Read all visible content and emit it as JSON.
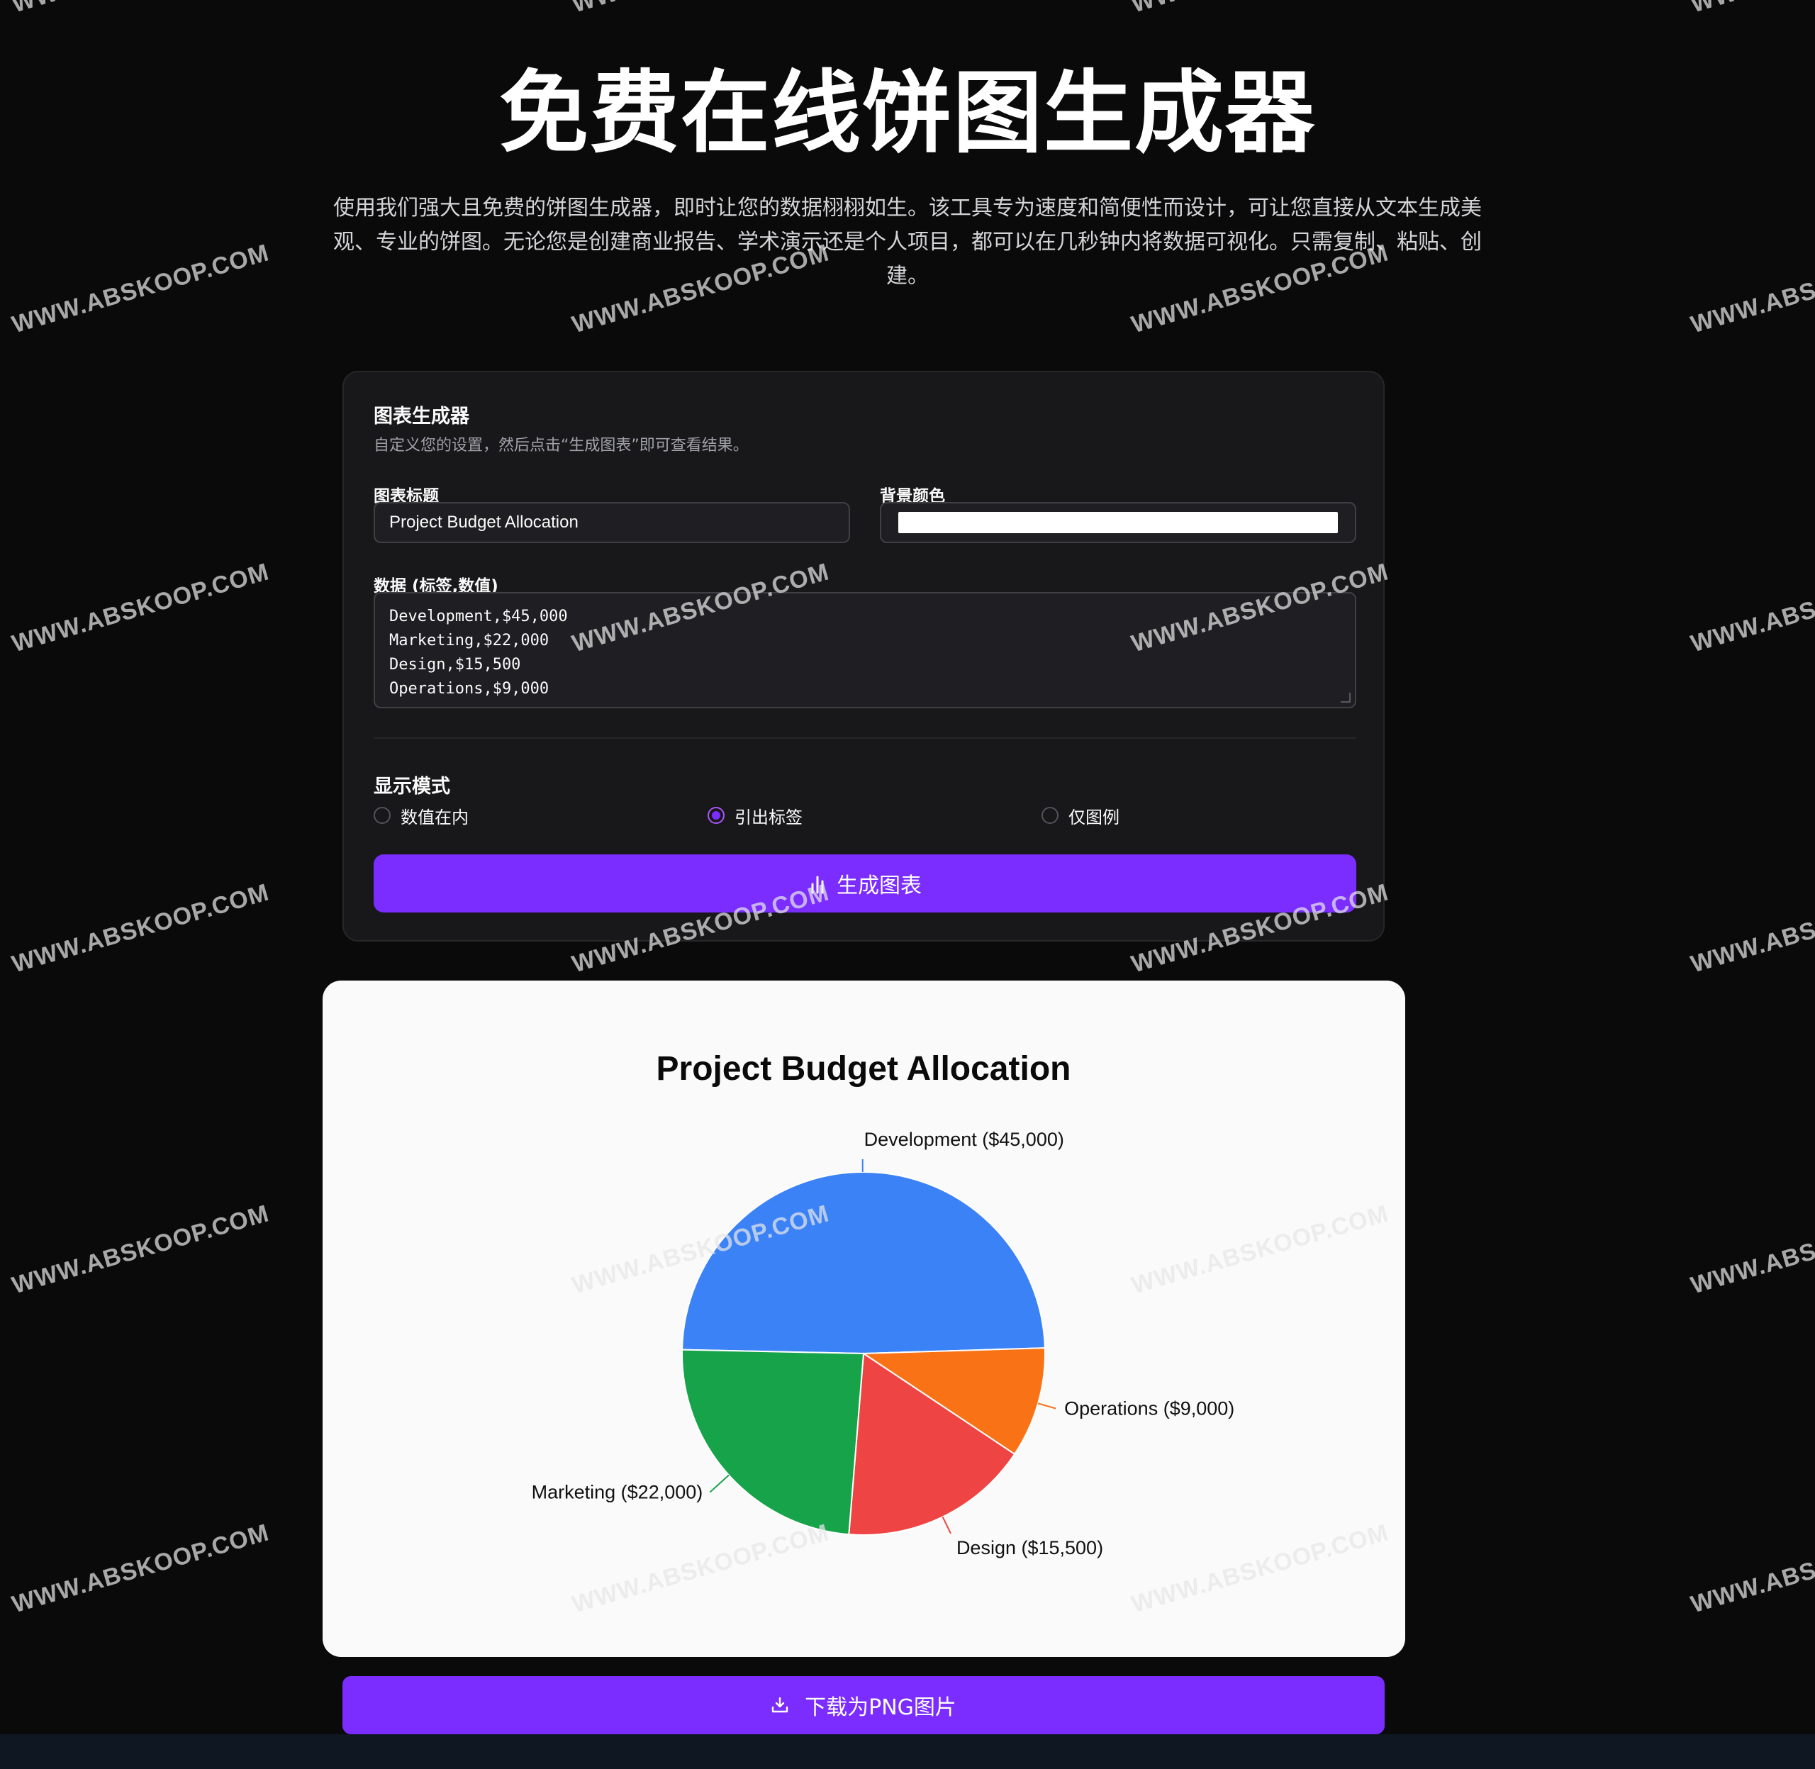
{
  "hero": {
    "title": "免费在线饼图生成器",
    "description": "使用我们强大且免费的饼图生成器，即时让您的数据栩栩如生。该工具专为速度和简便性而设计，可让您直接从文本生成美观、专业的饼图。无论您是创建商业报告、学术演示还是个人项目，都可以在几秒钟内将数据可视化。只需复制、粘贴、创建。"
  },
  "generator": {
    "title": "图表生成器",
    "subtitle": "自定义您的设置，然后点击“生成图表”即可查看结果。",
    "chart_title_label": "图表标题",
    "chart_title_value": "Project Budget Allocation",
    "bg_color_label": "背景颜色",
    "bg_color_value": "#ffffff",
    "data_label": "数据 (标签,数值)",
    "data_lines": [
      "Development,$45,000",
      "Marketing,$22,000",
      "Design,$15,500",
      "Operations,$9,000"
    ],
    "display_mode_label": "显示模式",
    "modes": [
      {
        "label": "数值在内",
        "selected": false
      },
      {
        "label": "引出标签",
        "selected": true
      },
      {
        "label": "仅图例",
        "selected": false
      }
    ],
    "generate_label": "生成图表",
    "generate_icon": "chart-icon"
  },
  "chart_data": {
    "type": "pie",
    "title": "Project Budget Allocation",
    "categories": [
      "Development",
      "Marketing",
      "Design",
      "Operations"
    ],
    "values": [
      45000,
      22000,
      15500,
      9000
    ],
    "labels": [
      "Development ($45,000)",
      "Marketing ($22,000)",
      "Design ($15,500)",
      "Operations ($9,000)"
    ],
    "colors": [
      "#3b82f6",
      "#16a34a",
      "#ef4444",
      "#f97316"
    ],
    "background": "#fafafa",
    "legend": "none"
  },
  "download": {
    "label": "下载为PNG图片",
    "icon": "download-icon"
  },
  "watermark_text": "WWW.ABSKOOP.COM",
  "colors": {
    "accent": "#7b2cff",
    "page_bg": "#0a0a0a",
    "card_bg": "#18181b"
  }
}
